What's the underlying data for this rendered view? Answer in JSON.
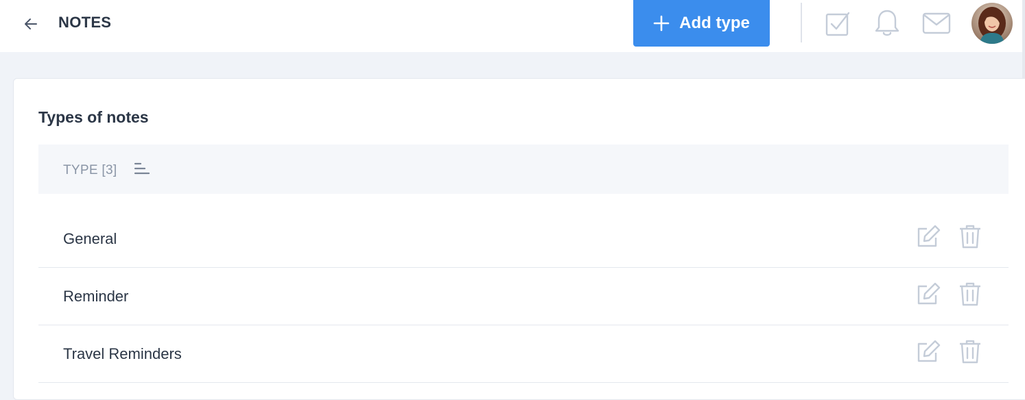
{
  "header": {
    "title": "NOTES",
    "add_button_label": "Add type",
    "icons": [
      "back-arrow-icon",
      "checkbox-icon",
      "bell-icon",
      "mail-icon"
    ]
  },
  "card": {
    "title": "Types of notes",
    "column_header": "TYPE [3]"
  },
  "rows": [
    {
      "label": "General"
    },
    {
      "label": "Reminder"
    },
    {
      "label": "Travel Reminders"
    }
  ],
  "colors": {
    "accent": "#3b8ded",
    "icon_muted": "#c4ccd8",
    "text": "#2b3646"
  }
}
